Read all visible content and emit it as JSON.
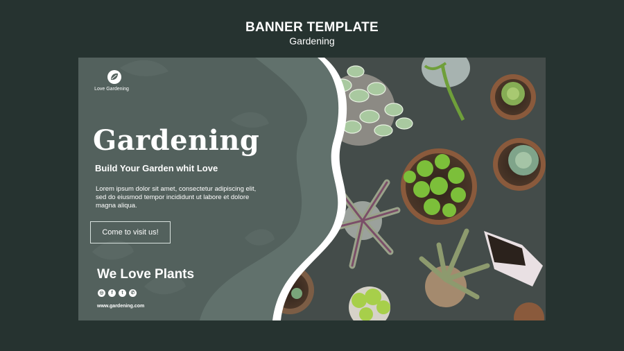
{
  "header": {
    "title": "BANNER TEMPLATE",
    "subtitle": "Gardening"
  },
  "banner": {
    "brand": {
      "name": "Love Gardening",
      "icon": "leaf-icon"
    },
    "title": "Gardening",
    "subtitle": "Build Your Garden whit Love",
    "body": "Lorem ipsum dolor sit amet, consectetur adipiscing elit, sed do eiusmod tempor incididunt ut labore et dolore magna aliqua.",
    "cta": "Come to visit us!",
    "tagline": "We Love Plants",
    "socials": [
      {
        "icon": "instagram-icon",
        "glyph": "◎"
      },
      {
        "icon": "facebook-icon",
        "glyph": "f"
      },
      {
        "icon": "twitter-icon",
        "glyph": "t"
      },
      {
        "icon": "whatsapp-icon",
        "glyph": "✆"
      }
    ],
    "website": "www.gardening.com"
  },
  "colors": {
    "background": "#263330",
    "panel": "#53615d",
    "panel_light": "#61716c",
    "photo_ground": "#3f4745",
    "leaf_green": "#8bc34a",
    "pot": "#8a5a3c"
  }
}
